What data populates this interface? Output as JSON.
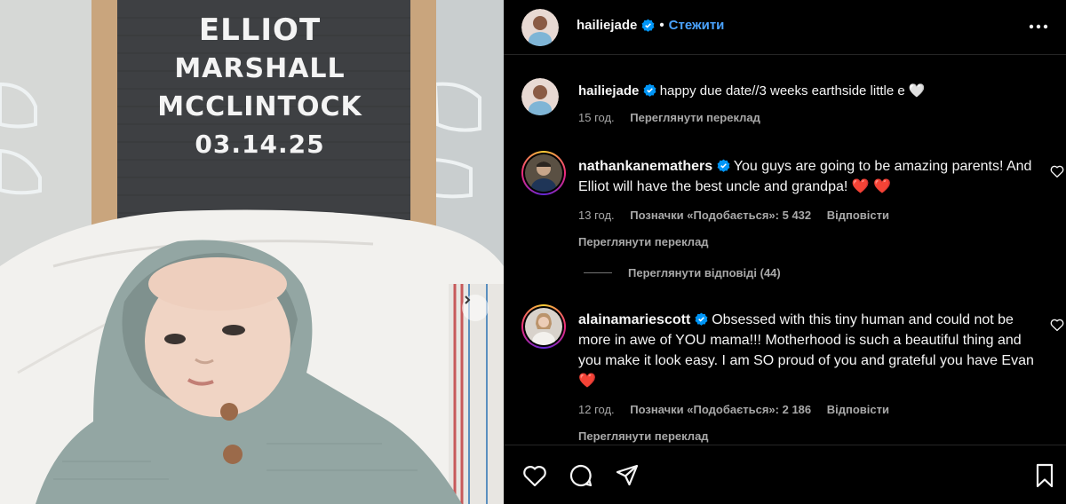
{
  "photo": {
    "board_lines": [
      "ELLIOT",
      "MARSHALL",
      "MCCLINTOCK",
      "03.14.25"
    ]
  },
  "header": {
    "username": "hailiejade",
    "separator": "•",
    "follow_label": "Стежити",
    "more_icon": "more-horizontal-icon"
  },
  "caption": {
    "username": "hailiejade",
    "text": "happy due date//3 weeks earthside little e",
    "emoji": "🤍",
    "time": "15 год.",
    "translate": "Переглянути переклад"
  },
  "comments": [
    {
      "username": "nathankanemathers",
      "text": "You guys are going to be amazing parents! And Elliot will have the best uncle and grandpa!",
      "emoji": "❤️ ❤️",
      "time": "13 год.",
      "likes": "Позначки «Подобається»: 5 432",
      "reply": "Відповісти",
      "translate": "Переглянути переклад"
    },
    {
      "username": "alainamariescott",
      "text": "Obsessed with this tiny human and could not be more in awe of YOU mama!!! Motherhood is such a beautiful thing and you make it look easy. I am SO proud of you and grateful you have Evan",
      "emoji": "❤️",
      "time": "12 год.",
      "likes": "Позначки «Подобається»: 2 186",
      "reply": "Відповісти",
      "translate": "Переглянути переклад"
    }
  ],
  "view_replies": "Переглянути відповіді (44)",
  "footer_icons": [
    "heart-icon",
    "comment-icon",
    "share-icon",
    "save-icon"
  ],
  "colors": {
    "background": "#000000",
    "link_blue": "#4aa3ff",
    "muted": "#a8a8a8",
    "verified": "#0095f6",
    "like_red": "#ed2b3c"
  }
}
